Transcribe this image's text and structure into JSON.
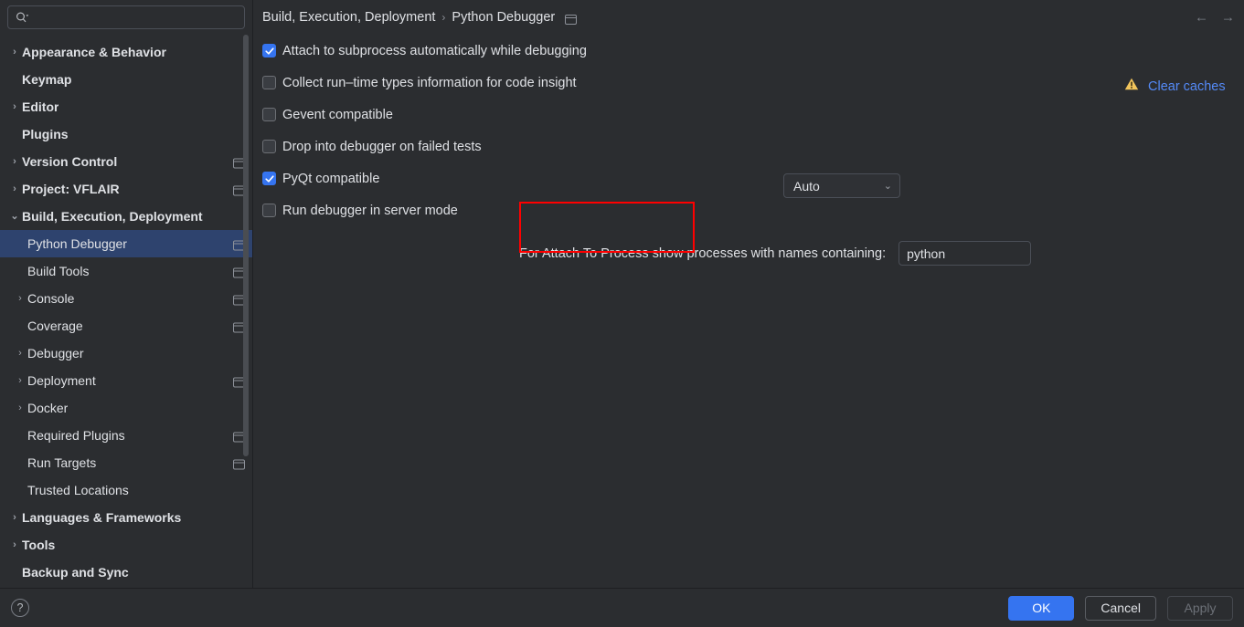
{
  "search": {
    "placeholder": "",
    "value": "",
    "icon": "search-icon"
  },
  "sidebar": {
    "items": [
      {
        "label": "Appearance & Behavior",
        "level": 0,
        "arrow": "›",
        "scope": false,
        "selected": false
      },
      {
        "label": "Keymap",
        "level": 0,
        "arrow": "",
        "scope": false,
        "selected": false
      },
      {
        "label": "Editor",
        "level": 0,
        "arrow": "›",
        "scope": false,
        "selected": false
      },
      {
        "label": "Plugins",
        "level": 0,
        "arrow": "",
        "scope": false,
        "selected": false
      },
      {
        "label": "Version Control",
        "level": 0,
        "arrow": "›",
        "scope": true,
        "selected": false
      },
      {
        "label": "Project: VFLAIR",
        "level": 0,
        "arrow": "›",
        "scope": true,
        "selected": false
      },
      {
        "label": "Build, Execution, Deployment",
        "level": 0,
        "arrow": "⌄",
        "scope": false,
        "selected": false
      },
      {
        "label": "Python Debugger",
        "level": 1,
        "arrow": "",
        "scope": true,
        "selected": true
      },
      {
        "label": "Build Tools",
        "level": 1,
        "arrow": "",
        "scope": true,
        "selected": false
      },
      {
        "label": "Console",
        "level": 1,
        "arrow": "›",
        "scope": true,
        "selected": false
      },
      {
        "label": "Coverage",
        "level": 1,
        "arrow": "",
        "scope": true,
        "selected": false
      },
      {
        "label": "Debugger",
        "level": 1,
        "arrow": "›",
        "scope": false,
        "selected": false
      },
      {
        "label": "Deployment",
        "level": 1,
        "arrow": "›",
        "scope": true,
        "selected": false
      },
      {
        "label": "Docker",
        "level": 1,
        "arrow": "›",
        "scope": false,
        "selected": false
      },
      {
        "label": "Required Plugins",
        "level": 1,
        "arrow": "",
        "scope": true,
        "selected": false
      },
      {
        "label": "Run Targets",
        "level": 1,
        "arrow": "",
        "scope": true,
        "selected": false
      },
      {
        "label": "Trusted Locations",
        "level": 1,
        "arrow": "",
        "scope": false,
        "selected": false
      },
      {
        "label": "Languages & Frameworks",
        "level": 0,
        "arrow": "›",
        "scope": false,
        "selected": false
      },
      {
        "label": "Tools",
        "level": 0,
        "arrow": "›",
        "scope": false,
        "selected": false
      },
      {
        "label": "Backup and Sync",
        "level": 0,
        "arrow": "",
        "scope": false,
        "selected": false
      }
    ]
  },
  "breadcrumb": {
    "parent": "Build, Execution, Deployment",
    "separator": "›",
    "current": "Python Debugger",
    "scope_icon": "project-scope-icon"
  },
  "nav": {
    "back": "←",
    "forward": "→"
  },
  "main": {
    "options": [
      {
        "label": "Attach to subprocess automatically while debugging",
        "checked": true
      },
      {
        "label": "Collect run–time types information for code insight",
        "checked": false
      },
      {
        "label": "Gevent compatible",
        "checked": false
      },
      {
        "label": "Drop into debugger on failed tests",
        "checked": false
      },
      {
        "label": "PyQt compatible",
        "checked": true
      },
      {
        "label": "Run debugger in server mode",
        "checked": false
      }
    ],
    "pyqt_dropdown": {
      "value": "Auto",
      "chevron": "⌄"
    },
    "attach_to_process": {
      "label": "For Attach To Process show processes with names containing:",
      "value": "python",
      "placeholder": ""
    },
    "clear_caches": {
      "label": "Clear caches",
      "icon": "warning-triangle-icon"
    },
    "highlight": {
      "target": "Run debugger in server mode",
      "color": "#ff0000"
    }
  },
  "footer": {
    "help": "?",
    "ok": "OK",
    "cancel": "Cancel",
    "apply": "Apply"
  },
  "colors": {
    "accent": "#3574f0",
    "selection": "#2e436e",
    "link": "#548af7",
    "warning": "#f2c55c",
    "background": "#2b2d30",
    "highlight": "#ff0000"
  }
}
